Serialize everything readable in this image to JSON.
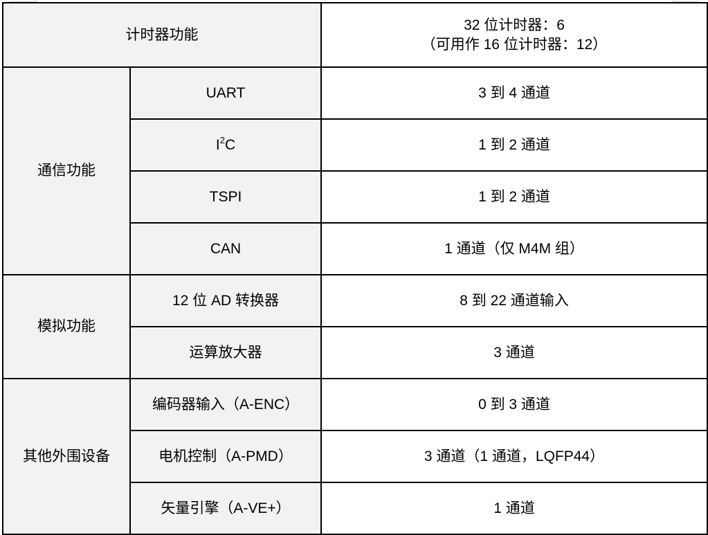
{
  "table": {
    "timer": {
      "label": "计时器功能",
      "value_line1": "32 位计时器：6",
      "value_line2": "（可用作 16 位计时器：12）"
    },
    "groups": [
      {
        "label": "通信功能",
        "rows": [
          {
            "feature": "UART",
            "value": "3 到 4 通道"
          },
          {
            "feature_base": "I",
            "feature_sup": "2",
            "feature_tail": "C",
            "value": "1 到 2 通道"
          },
          {
            "feature": "TSPI",
            "value": "1 到 2 通道"
          },
          {
            "feature": "CAN",
            "value": "1 通道（仅 M4M 组）"
          }
        ]
      },
      {
        "label": "模拟功能",
        "rows": [
          {
            "feature": "12 位 AD 转换器",
            "value": "8 到 22 通道输入"
          },
          {
            "feature": "运算放大器",
            "value": "3 通道"
          }
        ]
      },
      {
        "label": "其他外围设备",
        "rows": [
          {
            "feature": "编码器输入（A-ENC）",
            "value": "0 到 3 通道"
          },
          {
            "feature": "电机控制（A-PMD）",
            "value": "3 通道（1 通道，LQFP44）"
          },
          {
            "feature": "矢量引擎（A-VE+）",
            "value": "1 通道"
          }
        ]
      }
    ]
  }
}
